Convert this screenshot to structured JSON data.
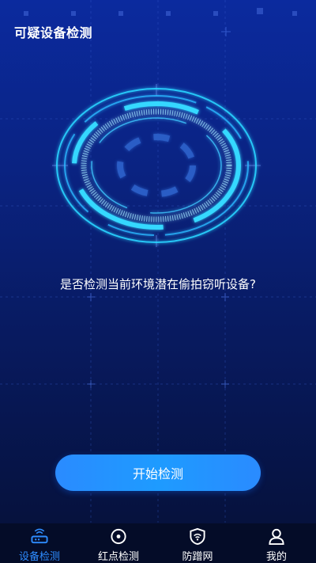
{
  "header": {
    "title": "可疑设备检测"
  },
  "main": {
    "prompt": "是否检测当前环境潜在偷拍窃听设备?",
    "start_button_label": "开始检测"
  },
  "tabbar": {
    "items": [
      {
        "label": "设备检测",
        "icon": "router-icon",
        "active": true
      },
      {
        "label": "红点检测",
        "icon": "target-icon",
        "active": false
      },
      {
        "label": "防蹭网",
        "icon": "wifi-shield-icon",
        "active": false
      },
      {
        "label": "我的",
        "icon": "user-icon",
        "active": false
      }
    ]
  },
  "colors": {
    "accent": "#2e8cff",
    "scanner_cyan": "#29d3ff",
    "background_top": "#0b2a9e",
    "background_bottom": "#051036",
    "tabbar_bg": "#040c28"
  }
}
